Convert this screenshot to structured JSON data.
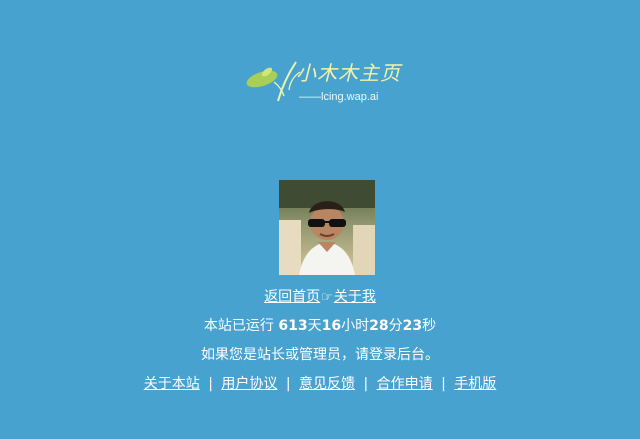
{
  "brand": {
    "logo_text": "小木木主页",
    "domain_text": "——lcing.wap.ai"
  },
  "nav": {
    "home": "返回首页",
    "hand": "☞",
    "about_me": "关于我"
  },
  "uptime": {
    "prefix": "本站已运行",
    "days": "613",
    "days_unit": "天",
    "hours": "16",
    "hours_unit": "小时",
    "minutes": "28",
    "minutes_unit": "分",
    "seconds": "23",
    "seconds_unit": "秒"
  },
  "admin_notice": "如果您是站长或管理员，请登录后台。",
  "footer": {
    "separator": "|",
    "links": [
      "关于本站",
      "用户协议",
      "意见反馈",
      "合作申请",
      "手机版"
    ]
  },
  "colors": {
    "background": "#47a2d0",
    "logo_text": "#f4f1a8",
    "leaf": "#b7d35a"
  }
}
